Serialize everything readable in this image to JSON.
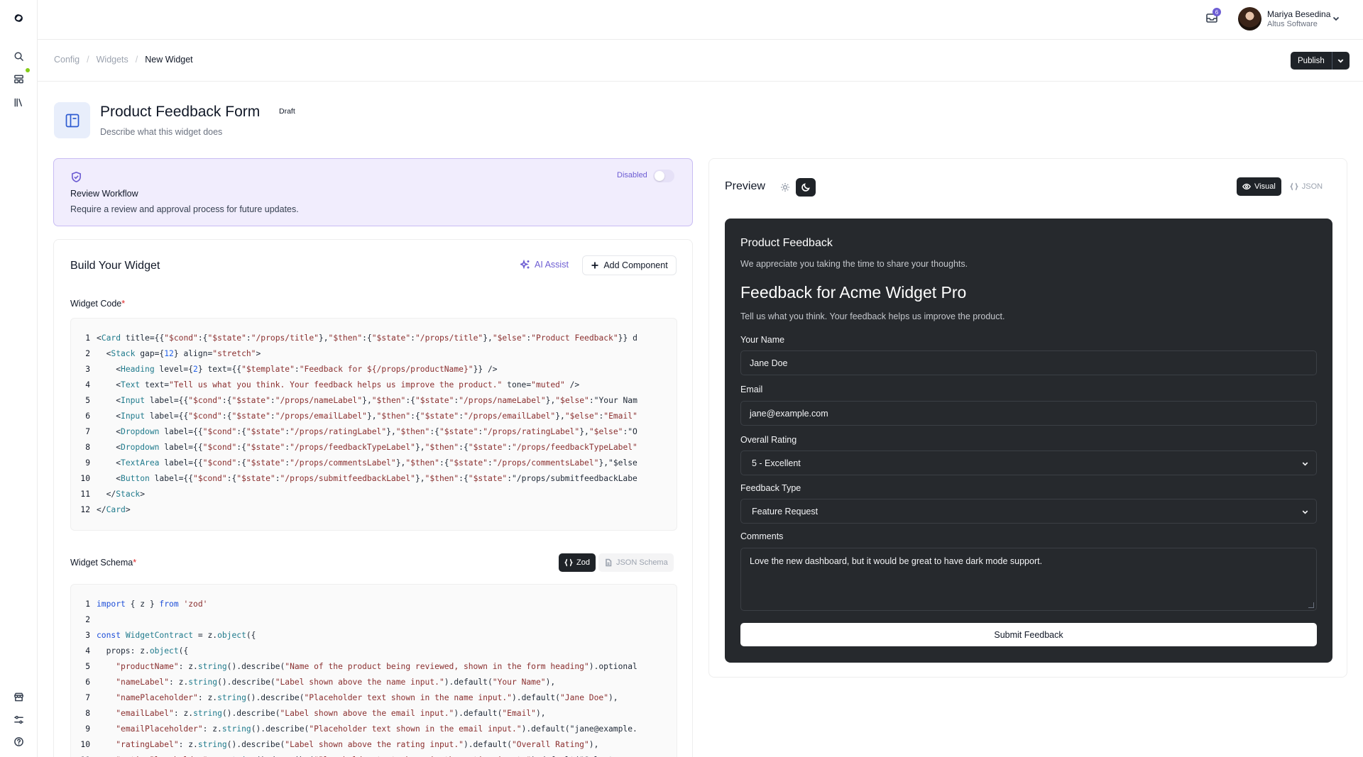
{
  "header": {
    "notifications_count": "6",
    "user": {
      "name": "Mariya Besedina",
      "org": "Altus Software"
    }
  },
  "breadcrumb": {
    "items": [
      "Config",
      "Widgets"
    ],
    "current": "New Widget"
  },
  "publish_label": "Publish",
  "widget": {
    "title": "Product Feedback Form",
    "status": "Draft",
    "description": "Describe what this widget does"
  },
  "review": {
    "title": "Review Workflow",
    "description": "Require a review and approval process for future updates.",
    "state_label": "Disabled",
    "enabled": false
  },
  "build": {
    "title": "Build Your Widget",
    "ai_assist": "AI Assist",
    "add_component": "Add Component",
    "code_label": "Widget Code",
    "schema_label": "Widget Schema",
    "required_mark": "*",
    "schema_tabs": [
      "Zod",
      "JSON Schema"
    ],
    "schema_active": "Zod",
    "code_lines": [
      "<Card title={{\"$cond\":{\"$state\":\"/props/title\"},\"$then\":{\"$state\":\"/props/title\"},\"$else\":\"Product Feedback\"}} d",
      "  <Stack gap={12} align=\"stretch\">",
      "    <Heading level={2} text={{\"$template\":\"Feedback for ${/props/productName}\"}} />",
      "    <Text text=\"Tell us what you think. Your feedback helps us improve the product.\" tone=\"muted\" />",
      "    <Input label={{\"$cond\":{\"$state\":\"/props/nameLabel\"},\"$then\":{\"$state\":\"/props/nameLabel\"},\"$else\":\"Your Nam",
      "    <Input label={{\"$cond\":{\"$state\":\"/props/emailLabel\"},\"$then\":{\"$state\":\"/props/emailLabel\"},\"$else\":\"Email\"",
      "    <Dropdown label={{\"$cond\":{\"$state\":\"/props/ratingLabel\"},\"$then\":{\"$state\":\"/props/ratingLabel\"},\"$else\":\"O",
      "    <Dropdown label={{\"$cond\":{\"$state\":\"/props/feedbackTypeLabel\"},\"$then\":{\"$state\":\"/props/feedbackTypeLabel\"",
      "    <TextArea label={{\"$cond\":{\"$state\":\"/props/commentsLabel\"},\"$then\":{\"$state\":\"/props/commentsLabel\"},\"$else",
      "    <Button label={{\"$cond\":{\"$state\":\"/props/submitfeedbackLabel\"},\"$then\":{\"$state\":\"/props/submitfeedbackLabe",
      "  </Stack>",
      "</Card>"
    ],
    "schema_lines": [
      "import { z } from 'zod'",
      "",
      "const WidgetContract = z.object({",
      "  props: z.object({",
      "    \"productName\": z.string().describe(\"Name of the product being reviewed, shown in the form heading\").optional",
      "    \"nameLabel\": z.string().describe(\"Label shown above the name input.\").default(\"Your Name\"),",
      "    \"namePlaceholder\": z.string().describe(\"Placeholder text shown in the name input.\").default(\"Jane Doe\"),",
      "    \"emailLabel\": z.string().describe(\"Label shown above the email input.\").default(\"Email\"),",
      "    \"emailPlaceholder\": z.string().describe(\"Placeholder text shown in the email input.\").default(\"jane@example.",
      "    \"ratingLabel\": z.string().describe(\"Label shown above the rating input.\").default(\"Overall Rating\"),",
      "    \"ratingPlaceholder\": z.string().describe(\"Placeholder text shown in the rating input.\").default(\"Select a ra"
    ]
  },
  "preview": {
    "title": "Preview",
    "view_tabs": [
      "Visual",
      "JSON"
    ],
    "view_active": "Visual",
    "theme_active": "dark",
    "card_title": "Product Feedback",
    "card_description": "We appreciate you taking the time to share your thoughts.",
    "heading": "Feedback for Acme Widget Pro",
    "intro": "Tell us what you think. Your feedback helps us improve the product.",
    "fields": {
      "name_label": "Your Name",
      "name_value": "Jane Doe",
      "email_label": "Email",
      "email_value": "jane@example.com",
      "rating_label": "Overall Rating",
      "rating_value": "5 - Excellent",
      "type_label": "Feedback Type",
      "type_value": "Feature Request",
      "comments_label": "Comments",
      "comments_value": "Love the new dashboard, but it would be great to have dark mode support."
    },
    "submit_label": "Submit Feedback"
  }
}
